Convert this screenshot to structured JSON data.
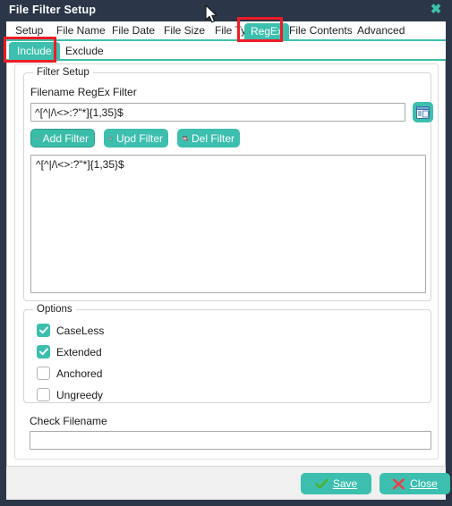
{
  "window": {
    "title": "File Filter Setup",
    "close_icon": "close-icon",
    "accent_color": "#3cbfae",
    "titlebar_color": "#2b3648",
    "annotation_color": "#ee1c25"
  },
  "tabs": [
    {
      "label": "Setup",
      "active": false
    },
    {
      "label": "File Name",
      "active": false
    },
    {
      "label": "File Date",
      "active": false
    },
    {
      "label": "File Size",
      "active": false
    },
    {
      "label": "File Type",
      "active": false
    },
    {
      "label": "RegEx",
      "active": true
    },
    {
      "label": "File Contents",
      "active": false
    },
    {
      "label": "Advanced",
      "active": false
    }
  ],
  "subtabs": [
    {
      "label": "Include",
      "active": true
    },
    {
      "label": "Exclude",
      "active": false
    }
  ],
  "filter_setup": {
    "group_label": "Filter Setup",
    "filter_field_label": "Filename RegEx Filter",
    "filter_value": "^[^|/\\<>:?\"*]{1,35}$",
    "filter_placeholder": "",
    "browse_icon": "document-list-icon",
    "buttons": [
      {
        "label": "Add Filter",
        "icon": "add-row-icon"
      },
      {
        "label": "Upd Filter",
        "icon": "update-row-icon"
      },
      {
        "label": "Del Filter",
        "icon": "delete-row-icon"
      }
    ],
    "filter_list_value": "^[^|/\\<>:?\"*]{1,35}$"
  },
  "options": {
    "group_label": "Options",
    "items": [
      {
        "label": "CaseLess",
        "checked": true
      },
      {
        "label": "Extended",
        "checked": true
      },
      {
        "label": "Anchored",
        "checked": false
      },
      {
        "label": "Ungreedy",
        "checked": false
      }
    ]
  },
  "check_filename": {
    "label": "Check Filename",
    "value": "",
    "placeholder": ""
  },
  "footer": {
    "save_label": "Save",
    "save_icon": "check-icon",
    "close_label": "Close",
    "close_icon": "x-icon"
  }
}
